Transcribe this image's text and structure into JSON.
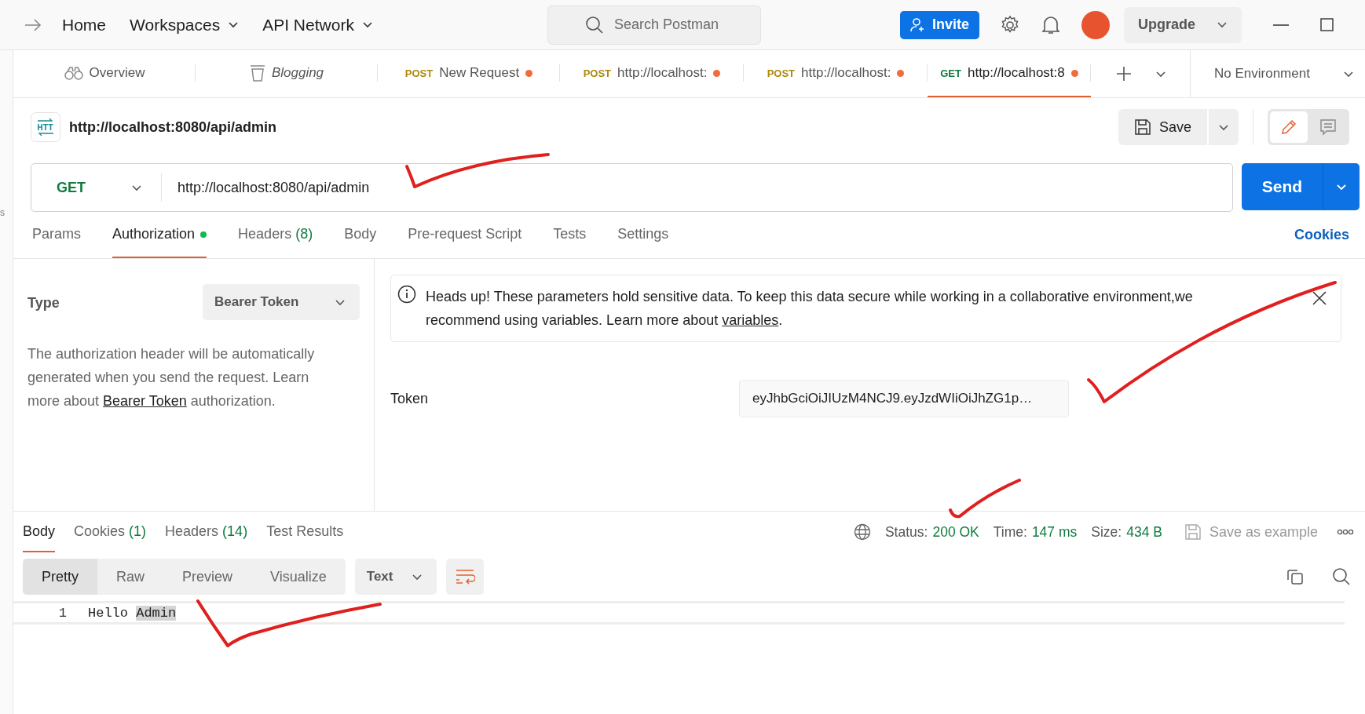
{
  "top_bar": {
    "nav_items": [
      {
        "label": "Home",
        "has_menu": false
      },
      {
        "label": "Workspaces",
        "has_menu": true
      },
      {
        "label": "API Network",
        "has_menu": true
      }
    ],
    "search": {
      "placeholder": "Search Postman"
    },
    "invite": "Invite",
    "upgrade": "Upgrade"
  },
  "left_strip": {
    "text": "s"
  },
  "tabs": [
    {
      "kind": "overview",
      "label": "Overview",
      "selected": false,
      "unsaved": false
    },
    {
      "kind": "collection",
      "label": "Blogging",
      "selected": false,
      "unsaved": false
    },
    {
      "kind": "request",
      "method": "POST",
      "label": "New Request",
      "selected": false,
      "unsaved": true
    },
    {
      "kind": "request",
      "method": "POST",
      "label": "http://localhost:",
      "selected": false,
      "unsaved": true
    },
    {
      "kind": "request",
      "method": "POST",
      "label": "http://localhost:",
      "selected": false,
      "unsaved": true
    },
    {
      "kind": "request",
      "method": "GET",
      "label": "http://localhost:8",
      "selected": true,
      "unsaved": true
    }
  ],
  "environment": "No Environment",
  "request": {
    "title": "http://localhost:8080/api/admin",
    "save": "Save",
    "method": "GET",
    "url": "http://localhost:8080/api/admin",
    "send": "Send"
  },
  "view_toggle": [
    {
      "kind": "edit",
      "selected": true
    },
    {
      "kind": "comments",
      "selected": false
    }
  ],
  "request_tabs": [
    {
      "label": "Params",
      "dot": false,
      "selected": false
    },
    {
      "label": "Authorization",
      "dot": true,
      "selected": true
    },
    {
      "label": "Headers",
      "count": "(8)",
      "dot": false,
      "selected": false
    },
    {
      "label": "Body",
      "dot": false,
      "selected": false
    },
    {
      "label": "Pre-request Script",
      "dot": false,
      "selected": false
    },
    {
      "label": "Tests",
      "dot": false,
      "selected": false
    },
    {
      "label": "Settings",
      "dot": false,
      "selected": false
    }
  ],
  "cookies_link": "Cookies",
  "auth": {
    "type_label": "Type",
    "type_value": "Bearer Token",
    "description": {
      "before": "The authorization header will be automatically generated when you send the request. Learn more about",
      "link": "Bearer Token",
      "after": "authorization."
    },
    "notice": {
      "before": "Heads up! These parameters hold sensitive data. To keep this data secure while working in a collaborative environment,we recommend using variables. Learn more about",
      "link": "variables",
      "after": "."
    },
    "token_label": "Token",
    "token_value": "eyJhbGciOiJIUzM4NCJ9.eyJzdWIiOiJhZG1p…"
  },
  "response": {
    "tabs": [
      {
        "label": "Body",
        "selected": true
      },
      {
        "label": "Cookies",
        "count": "(1)",
        "selected": false
      },
      {
        "label": "Headers",
        "count": "(14)",
        "selected": false
      },
      {
        "label": "Test Results",
        "selected": false
      }
    ],
    "stats": [
      {
        "label": "Status:",
        "value": "200 OK"
      },
      {
        "label": "Time:",
        "value": "147 ms"
      },
      {
        "label": "Size:",
        "value": "434 B"
      }
    ],
    "save_example": "Save as example",
    "view_modes": [
      {
        "label": "Pretty",
        "selected": true
      },
      {
        "label": "Raw",
        "selected": false
      },
      {
        "label": "Preview",
        "selected": false
      },
      {
        "label": "Visualize",
        "selected": false
      }
    ],
    "format": "Text",
    "lines": [
      {
        "number": "1",
        "segments": [
          {
            "text": "Hello ",
            "highlighted": false
          },
          {
            "text": "Admin",
            "highlighted": true
          }
        ]
      }
    ]
  }
}
